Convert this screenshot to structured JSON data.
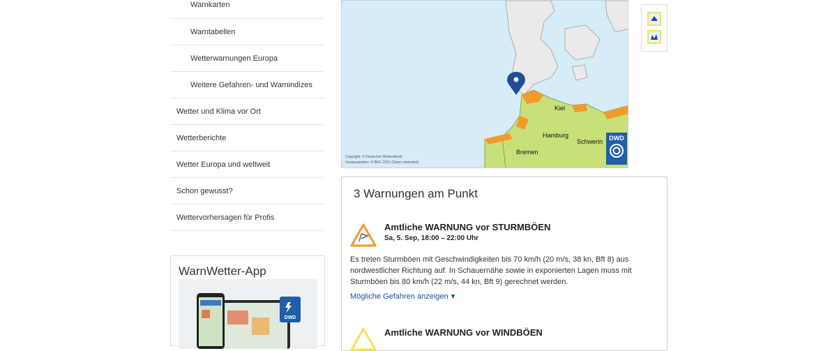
{
  "nav": {
    "sub_items": [
      "Warnkarten",
      "Warntabellen",
      "Wetterwarnungen Europa",
      "Weitere Gefahren- und Warnindizes"
    ],
    "top_items": [
      "Wetter und Klima vor Ort",
      "Wetterberichte",
      "Wetter Europa und weltweit",
      "Schon gewusst?",
      "Wettervorhersagen für Profis"
    ]
  },
  "app_box": {
    "title": "WarnWetter-App",
    "badge": "DWD"
  },
  "map": {
    "cities": [
      "Kiel",
      "Hamburg",
      "Schwerin",
      "Bremen"
    ],
    "copyright_line1": "Copyright: © Deutscher Wetterdienst",
    "copyright_line2": "Geobasisdaten: © BKG 2015 (Daten verändert)",
    "logo_text": "DWD",
    "colors": {
      "water": "#d6ecf8",
      "land_neutral": "#eaeaea",
      "land_warned": "#c8e07a",
      "orange": "#f39a2b"
    }
  },
  "legend": {
    "icons": [
      "storm-warning-icon",
      "wind-warning-icon"
    ]
  },
  "warnings": {
    "title": "3 Warnungen am Punkt",
    "items": [
      {
        "heading": "Amtliche WARNUNG vor STURMBÖEN",
        "time": "Sa, 5. Sep, 18:00 – 22:00 Uhr",
        "text": "Es treten Sturmböen mit Geschwindigkeiten bis 70 km/h (20 m/s, 38 kn, Bft 8) aus nordwestlicher Richtung auf. In Schauernähe sowie in exponierten Lagen muss mit Sturmböen bis 80 km/h (22 m/s, 44 kn, Bft 9) gerechnet werden.",
        "link": "Mögliche Gefahren anzeigen",
        "color": "#f39a2b"
      },
      {
        "heading": "Amtliche WARNUNG vor WINDBÖEN",
        "color": "#f2e35a"
      }
    ]
  }
}
